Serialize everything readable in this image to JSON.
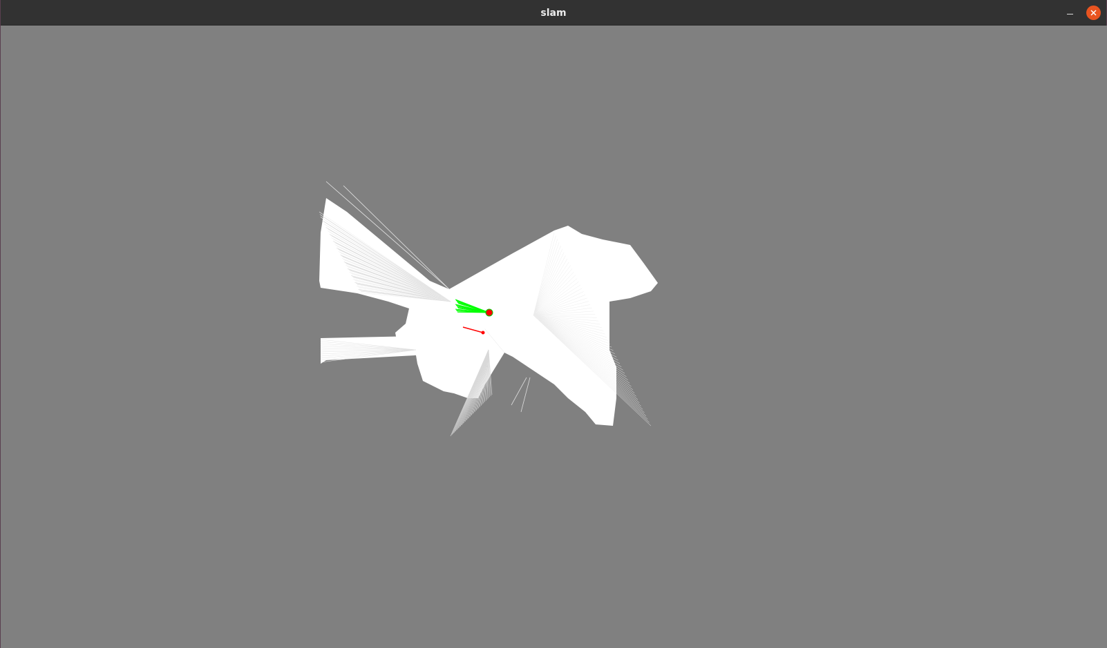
{
  "window": {
    "title": "slam",
    "minimize_icon": "minimize-icon",
    "close_icon": "close-icon"
  },
  "colors": {
    "background": "#808080",
    "free_space": "#ffffff",
    "scan_rays": "#f2f2f2",
    "particles": "#00ff00",
    "robot": "#ff0000",
    "close_button": "#e95420",
    "titlebar": "#323232"
  },
  "map": {
    "content": "occupancy-grid",
    "robot_marker": "red-circle",
    "particle_rays": "green-lines",
    "trajectory_marker": "red-line"
  }
}
